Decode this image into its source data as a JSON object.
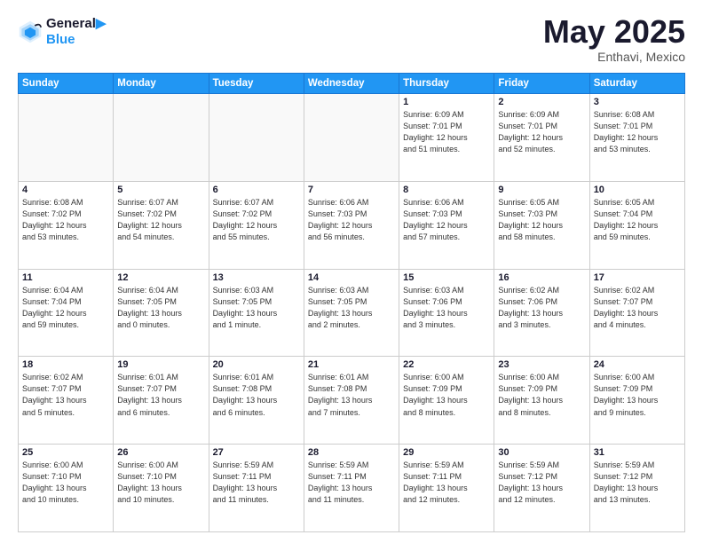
{
  "header": {
    "logo_line1": "General",
    "logo_line2": "Blue",
    "month_title": "May 2025",
    "location": "Enthavi, Mexico"
  },
  "weekdays": [
    "Sunday",
    "Monday",
    "Tuesday",
    "Wednesday",
    "Thursday",
    "Friday",
    "Saturday"
  ],
  "weeks": [
    [
      {
        "day": "",
        "info": ""
      },
      {
        "day": "",
        "info": ""
      },
      {
        "day": "",
        "info": ""
      },
      {
        "day": "",
        "info": ""
      },
      {
        "day": "1",
        "info": "Sunrise: 6:09 AM\nSunset: 7:01 PM\nDaylight: 12 hours\nand 51 minutes."
      },
      {
        "day": "2",
        "info": "Sunrise: 6:09 AM\nSunset: 7:01 PM\nDaylight: 12 hours\nand 52 minutes."
      },
      {
        "day": "3",
        "info": "Sunrise: 6:08 AM\nSunset: 7:01 PM\nDaylight: 12 hours\nand 53 minutes."
      }
    ],
    [
      {
        "day": "4",
        "info": "Sunrise: 6:08 AM\nSunset: 7:02 PM\nDaylight: 12 hours\nand 53 minutes."
      },
      {
        "day": "5",
        "info": "Sunrise: 6:07 AM\nSunset: 7:02 PM\nDaylight: 12 hours\nand 54 minutes."
      },
      {
        "day": "6",
        "info": "Sunrise: 6:07 AM\nSunset: 7:02 PM\nDaylight: 12 hours\nand 55 minutes."
      },
      {
        "day": "7",
        "info": "Sunrise: 6:06 AM\nSunset: 7:03 PM\nDaylight: 12 hours\nand 56 minutes."
      },
      {
        "day": "8",
        "info": "Sunrise: 6:06 AM\nSunset: 7:03 PM\nDaylight: 12 hours\nand 57 minutes."
      },
      {
        "day": "9",
        "info": "Sunrise: 6:05 AM\nSunset: 7:03 PM\nDaylight: 12 hours\nand 58 minutes."
      },
      {
        "day": "10",
        "info": "Sunrise: 6:05 AM\nSunset: 7:04 PM\nDaylight: 12 hours\nand 59 minutes."
      }
    ],
    [
      {
        "day": "11",
        "info": "Sunrise: 6:04 AM\nSunset: 7:04 PM\nDaylight: 12 hours\nand 59 minutes."
      },
      {
        "day": "12",
        "info": "Sunrise: 6:04 AM\nSunset: 7:05 PM\nDaylight: 13 hours\nand 0 minutes."
      },
      {
        "day": "13",
        "info": "Sunrise: 6:03 AM\nSunset: 7:05 PM\nDaylight: 13 hours\nand 1 minute."
      },
      {
        "day": "14",
        "info": "Sunrise: 6:03 AM\nSunset: 7:05 PM\nDaylight: 13 hours\nand 2 minutes."
      },
      {
        "day": "15",
        "info": "Sunrise: 6:03 AM\nSunset: 7:06 PM\nDaylight: 13 hours\nand 3 minutes."
      },
      {
        "day": "16",
        "info": "Sunrise: 6:02 AM\nSunset: 7:06 PM\nDaylight: 13 hours\nand 3 minutes."
      },
      {
        "day": "17",
        "info": "Sunrise: 6:02 AM\nSunset: 7:07 PM\nDaylight: 13 hours\nand 4 minutes."
      }
    ],
    [
      {
        "day": "18",
        "info": "Sunrise: 6:02 AM\nSunset: 7:07 PM\nDaylight: 13 hours\nand 5 minutes."
      },
      {
        "day": "19",
        "info": "Sunrise: 6:01 AM\nSunset: 7:07 PM\nDaylight: 13 hours\nand 6 minutes."
      },
      {
        "day": "20",
        "info": "Sunrise: 6:01 AM\nSunset: 7:08 PM\nDaylight: 13 hours\nand 6 minutes."
      },
      {
        "day": "21",
        "info": "Sunrise: 6:01 AM\nSunset: 7:08 PM\nDaylight: 13 hours\nand 7 minutes."
      },
      {
        "day": "22",
        "info": "Sunrise: 6:00 AM\nSunset: 7:09 PM\nDaylight: 13 hours\nand 8 minutes."
      },
      {
        "day": "23",
        "info": "Sunrise: 6:00 AM\nSunset: 7:09 PM\nDaylight: 13 hours\nand 8 minutes."
      },
      {
        "day": "24",
        "info": "Sunrise: 6:00 AM\nSunset: 7:09 PM\nDaylight: 13 hours\nand 9 minutes."
      }
    ],
    [
      {
        "day": "25",
        "info": "Sunrise: 6:00 AM\nSunset: 7:10 PM\nDaylight: 13 hours\nand 10 minutes."
      },
      {
        "day": "26",
        "info": "Sunrise: 6:00 AM\nSunset: 7:10 PM\nDaylight: 13 hours\nand 10 minutes."
      },
      {
        "day": "27",
        "info": "Sunrise: 5:59 AM\nSunset: 7:11 PM\nDaylight: 13 hours\nand 11 minutes."
      },
      {
        "day": "28",
        "info": "Sunrise: 5:59 AM\nSunset: 7:11 PM\nDaylight: 13 hours\nand 11 minutes."
      },
      {
        "day": "29",
        "info": "Sunrise: 5:59 AM\nSunset: 7:11 PM\nDaylight: 13 hours\nand 12 minutes."
      },
      {
        "day": "30",
        "info": "Sunrise: 5:59 AM\nSunset: 7:12 PM\nDaylight: 13 hours\nand 12 minutes."
      },
      {
        "day": "31",
        "info": "Sunrise: 5:59 AM\nSunset: 7:12 PM\nDaylight: 13 hours\nand 13 minutes."
      }
    ]
  ]
}
